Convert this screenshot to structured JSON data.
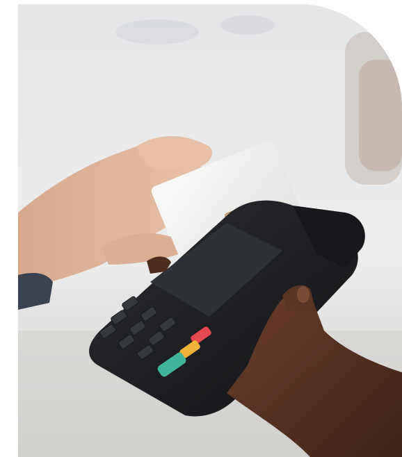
{
  "image": {
    "subject": "photo",
    "corner_style": "rounded-top-right",
    "colors": {
      "background": "#e6e7e9",
      "terminal_body": "#1f2124",
      "screen": "#2b2f33",
      "card": "#f4f4f2",
      "chip": "#c9a97a",
      "key_red": "#e5484d",
      "key_yellow": "#f2b33d",
      "key_green": "#3fb59a",
      "skin_light": "#e3b89c",
      "skin_dark": "#5a3423"
    }
  }
}
